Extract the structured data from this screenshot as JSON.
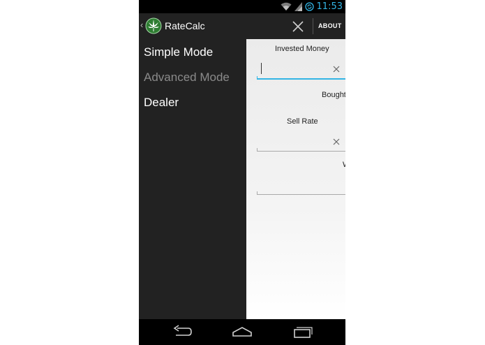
{
  "status_bar": {
    "time": "11:53",
    "icons": [
      "wifi-icon",
      "signal-icon",
      "sync-icon"
    ]
  },
  "action_bar": {
    "title": "RateCalc",
    "about_label": "ABOUT",
    "close_icon": "close-icon",
    "logo_icon": "leaf-logo-icon"
  },
  "drawer": {
    "items": [
      {
        "label": "Simple Mode",
        "state": "normal"
      },
      {
        "label": "Advanced Mode",
        "state": "dimmed"
      },
      {
        "label": "Dealer",
        "state": "normal"
      }
    ]
  },
  "form": {
    "invested_money_label": "Invested Money",
    "bought_label": "Bought",
    "sell_rate_label": "Sell Rate",
    "truncated_label": "W",
    "invested_money_value": "",
    "sell_rate_value": ""
  },
  "nav_bar": {
    "icons": [
      "back-icon",
      "home-icon",
      "recent-apps-icon"
    ]
  },
  "colors": {
    "accent": "#33b5e5",
    "drawer_bg": "#222222",
    "actionbar_bg": "#222222"
  }
}
